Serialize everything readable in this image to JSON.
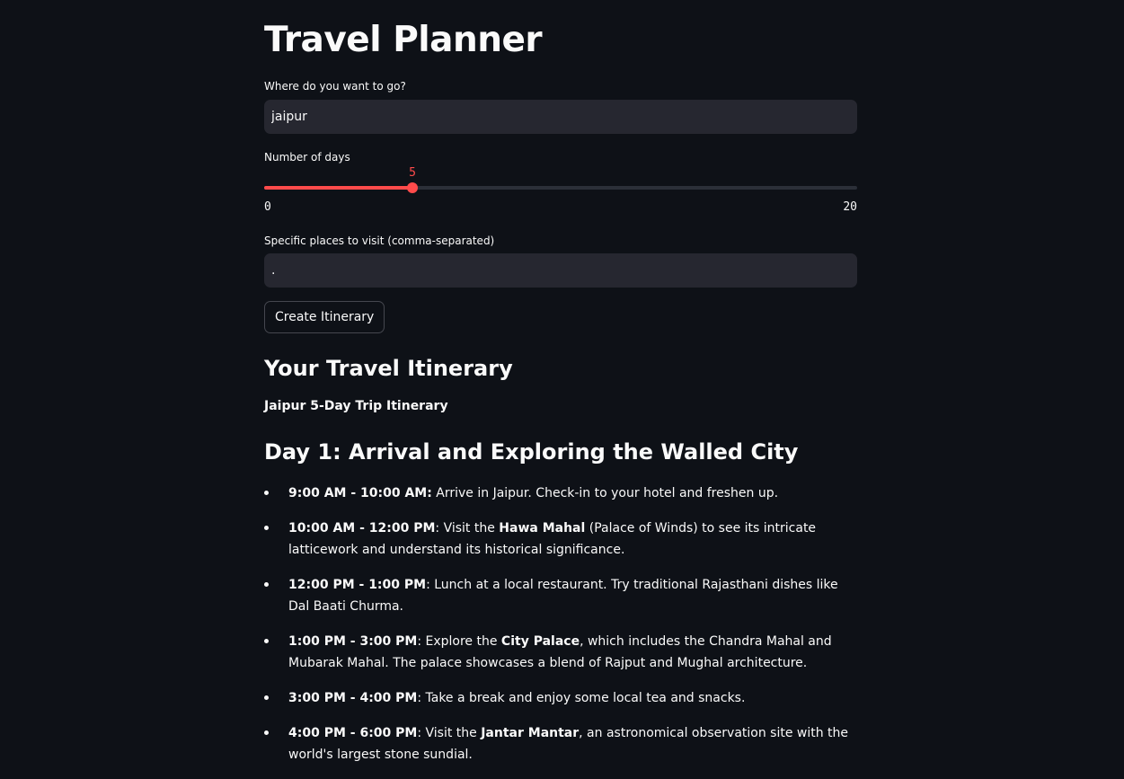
{
  "app": {
    "title": "Travel Planner"
  },
  "destination": {
    "label": "Where do you want to go?",
    "value": "jaipur"
  },
  "days": {
    "label": "Number of days",
    "value": 5,
    "min": 0,
    "max": 20,
    "value_label": "5",
    "min_label": "0",
    "max_label": "20"
  },
  "places": {
    "label": "Specific places to visit (comma-separated)",
    "value": "."
  },
  "create_button": {
    "label": "Create Itinerary"
  },
  "itinerary": {
    "section_title": "Your Travel Itinerary",
    "trip_title": "Jaipur 5-Day Trip Itinerary",
    "day1": {
      "title": "Day 1: Arrival and Exploring the Walled City",
      "items": [
        {
          "time": "9:00 AM - 10:00 AM:",
          "text1": " Arrive in Jaipur. Check-in to your hotel and freshen up.",
          "place": "",
          "text2": ""
        },
        {
          "time": "10:00 AM - 12:00 PM",
          "text1": ": Visit the ",
          "place": "Hawa Mahal",
          "text2": " (Palace of Winds) to see its intricate latticework and understand its historical significance."
        },
        {
          "time": "12:00 PM - 1:00 PM",
          "text1": ": Lunch at a local restaurant. Try traditional Rajasthani dishes like Dal Baati Churma.",
          "place": "",
          "text2": ""
        },
        {
          "time": "1:00 PM - 3:00 PM",
          "text1": ": Explore the ",
          "place": "City Palace",
          "text2": ", which includes the Chandra Mahal and Mubarak Mahal. The palace showcases a blend of Rajput and Mughal architecture."
        },
        {
          "time": "3:00 PM - 4:00 PM",
          "text1": ": Take a break and enjoy some local tea and snacks.",
          "place": "",
          "text2": ""
        },
        {
          "time": "4:00 PM - 6:00 PM",
          "text1": ": Visit the ",
          "place": "Jantar Mantar",
          "text2": ", an astronomical observation site with the world's largest stone sundial."
        }
      ]
    }
  }
}
